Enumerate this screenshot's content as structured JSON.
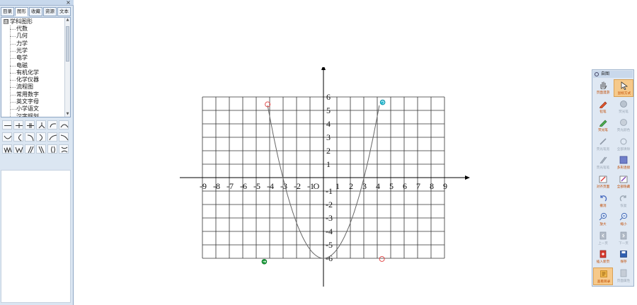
{
  "left_panel": {
    "close_glyph": "×",
    "tabs": [
      {
        "label": "目录",
        "active": false
      },
      {
        "label": "图形",
        "active": true
      },
      {
        "label": "收藏",
        "active": false
      },
      {
        "label": "资源",
        "active": false
      },
      {
        "label": "文本",
        "active": false
      }
    ],
    "tree": {
      "expander": "⊟",
      "root": "学科图形",
      "items": [
        "代数",
        "几何",
        "力学",
        "光学",
        "电学",
        "电磁",
        "有机化学",
        "化学仪器",
        "流程图",
        "常用数字",
        "英文字母",
        "小学语文",
        "汉字规划"
      ]
    },
    "symbols": [
      "dash-line",
      "cross-tick",
      "cross-double",
      "y-branch",
      "hook",
      "cap-arc",
      "cup-arc",
      "left-arc",
      "right-down-arc",
      "right-arc",
      "rise-curve",
      "fall-curve",
      "w-wave",
      "w-shape",
      "double-slash",
      "double-backslash",
      "paren-pair",
      "x-cross"
    ]
  },
  "graph": {
    "x_ticks": [
      "-9",
      "-8",
      "-7",
      "-6",
      "-5",
      "-4",
      "-3",
      "-2",
      "-1",
      "1",
      "2",
      "3",
      "4",
      "5",
      "6",
      "7",
      "8",
      "9"
    ],
    "y_ticks_pos": [
      "1",
      "2",
      "3",
      "4",
      "5",
      "6"
    ],
    "y_ticks_neg": [
      "-1",
      "-2",
      "-3",
      "-4",
      "-5",
      "-6"
    ],
    "origin_label": "O",
    "curve_color": "#666666",
    "marker_red": "#e04040",
    "marker_cyan": "#20b8d0",
    "marker_green": "#1a9a3a"
  },
  "toolbar": {
    "title": "自图",
    "buttons": [
      {
        "label": "页面漫游",
        "icon": "hand-icon",
        "active": false,
        "enabled": true
      },
      {
        "label": "鼠标方式",
        "icon": "cursor-icon",
        "active": true,
        "enabled": true
      },
      {
        "label": "铅笔",
        "icon": "pencil-icon",
        "active": false,
        "enabled": true
      },
      {
        "label": "荧光笔",
        "icon": "highlighter-icon",
        "active": false,
        "enabled": false
      },
      {
        "label": "荧光笔",
        "icon": "green-pen-icon",
        "active": false,
        "enabled": true
      },
      {
        "label": "荧光颜色",
        "icon": "palette-icon",
        "active": false,
        "enabled": false
      },
      {
        "label": "荧光笔宽",
        "icon": "pen-width-icon",
        "active": false,
        "enabled": false
      },
      {
        "label": "全部清除",
        "icon": "clear-icon",
        "active": false,
        "enabled": false
      },
      {
        "label": "荧光笔笔",
        "icon": "brush-icon",
        "active": false,
        "enabled": false
      },
      {
        "label": "多形连接",
        "icon": "connect-icon",
        "active": false,
        "enabled": true
      },
      {
        "label": "对齐页面",
        "icon": "align-icon",
        "active": false,
        "enabled": true
      },
      {
        "label": "全部隐藏",
        "icon": "hide-icon",
        "active": false,
        "enabled": true
      },
      {
        "label": "撤消",
        "icon": "undo-icon",
        "active": false,
        "enabled": true
      },
      {
        "label": "恢复",
        "icon": "redo-icon",
        "active": false,
        "enabled": false
      },
      {
        "label": "放大",
        "icon": "zoom-in-icon",
        "active": false,
        "enabled": true
      },
      {
        "label": "缩小",
        "icon": "zoom-out-icon",
        "active": false,
        "enabled": true
      },
      {
        "label": "上一页",
        "icon": "prev-page-icon",
        "active": false,
        "enabled": false
      },
      {
        "label": "下一页",
        "icon": "next-page-icon",
        "active": false,
        "enabled": false
      },
      {
        "label": "插入新页",
        "icon": "insert-page-icon",
        "active": false,
        "enabled": true
      },
      {
        "label": "保存",
        "icon": "save-icon",
        "active": false,
        "enabled": true
      },
      {
        "label": "查看目录",
        "icon": "catalog-icon",
        "active": true,
        "enabled": true
      },
      {
        "label": "页面属性",
        "icon": "page-props-icon",
        "active": false,
        "enabled": false
      }
    ]
  }
}
